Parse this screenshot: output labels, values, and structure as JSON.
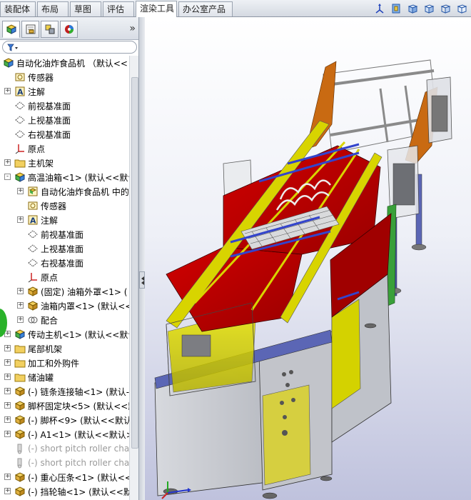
{
  "command_tabs": [
    {
      "label": "装配体",
      "active": false
    },
    {
      "label": "布局",
      "active": false
    },
    {
      "label": "草图",
      "active": false
    },
    {
      "label": "评估",
      "active": false
    },
    {
      "label": "渲染工具",
      "active": true
    },
    {
      "label": "办公室产品",
      "active": false
    }
  ],
  "view_toolbar_icons": [
    "triad-view-icon",
    "section-view-icon",
    "cube-view-icon",
    "cube-view-shaded-icon",
    "cube-view-edges-icon",
    "cube-view-more-icon"
  ],
  "panel_tabs": [
    "feature-manager-icon",
    "property-manager-icon",
    "configuration-manager-icon",
    "appearance-manager-icon"
  ],
  "panel_expand": "»",
  "tree": {
    "items": [
      {
        "label": "自动化油炸食品机 （默认<<",
        "icon": "assembly-root-icon",
        "expander": "",
        "level": 0
      },
      {
        "label": "传感器",
        "icon": "sensor-icon",
        "expander": "",
        "level": 1
      },
      {
        "label": "注解",
        "icon": "annotation-icon",
        "expander": "+",
        "level": 1
      },
      {
        "label": "前视基准面",
        "icon": "plane-icon",
        "expander": "",
        "level": 1
      },
      {
        "label": "上视基准面",
        "icon": "plane-icon",
        "expander": "",
        "level": 1
      },
      {
        "label": "右视基准面",
        "icon": "plane-icon",
        "expander": "",
        "level": 1
      },
      {
        "label": "原点",
        "icon": "origin-icon",
        "expander": "",
        "level": 1
      },
      {
        "label": "主机架",
        "icon": "folder-icon",
        "expander": "+",
        "level": 1
      },
      {
        "label": "高温油箱<1> (默认<<默认",
        "icon": "subassembly-icon",
        "expander": "-",
        "level": 1
      },
      {
        "label": "自动化油炸食品机 中的",
        "icon": "mate-ref-icon",
        "expander": "+",
        "level": 2
      },
      {
        "label": "传感器",
        "icon": "sensor-icon",
        "expander": "",
        "level": 2
      },
      {
        "label": "注解",
        "icon": "annotation-icon",
        "expander": "+",
        "level": 2
      },
      {
        "label": "前视基准面",
        "icon": "plane-icon",
        "expander": "",
        "level": 2
      },
      {
        "label": "上视基准面",
        "icon": "plane-icon",
        "expander": "",
        "level": 2
      },
      {
        "label": "右视基准面",
        "icon": "plane-icon",
        "expander": "",
        "level": 2
      },
      {
        "label": "原点",
        "icon": "origin-icon",
        "expander": "",
        "level": 2
      },
      {
        "label": "(固定) 油箱外罩<1> (",
        "icon": "part-icon",
        "expander": "+",
        "level": 2
      },
      {
        "label": "油箱内罩<1> (默认<<扌",
        "icon": "part-icon",
        "expander": "+",
        "level": 2
      },
      {
        "label": "配合",
        "icon": "mates-icon",
        "expander": "+",
        "level": 2
      },
      {
        "label": "传动主机<1> (默认<<默认",
        "icon": "subassembly-icon",
        "expander": "+",
        "level": 1
      },
      {
        "label": "尾部机架",
        "icon": "folder-icon",
        "expander": "+",
        "level": 1
      },
      {
        "label": "加工和外购件",
        "icon": "folder-icon",
        "expander": "+",
        "level": 1
      },
      {
        "label": "储油罐",
        "icon": "folder-icon",
        "expander": "+",
        "level": 1
      },
      {
        "label": "(-) 链条连接轴<1> (默认-",
        "icon": "part-icon",
        "expander": "+",
        "level": 1
      },
      {
        "label": "脚杯固定块<5> (默认<<默",
        "icon": "part-icon",
        "expander": "+",
        "level": 1
      },
      {
        "label": "(-) 脚杯<9> (默认<<默认",
        "icon": "part-icon",
        "expander": "+",
        "level": 1
      },
      {
        "label": "(-) A1<1> (默认<<默认>",
        "icon": "part-icon",
        "expander": "+",
        "level": 1
      },
      {
        "label": "(-) short pitch roller cha",
        "icon": "suppressed-part-icon",
        "expander": "",
        "level": 1,
        "grey": true
      },
      {
        "label": "(-) short pitch roller cha",
        "icon": "suppressed-part-icon",
        "expander": "",
        "level": 1,
        "grey": true
      },
      {
        "label": "(-) 重心压条<1> (默认<<",
        "icon": "part-icon",
        "expander": "+",
        "level": 1
      },
      {
        "label": "(-) 挡轮轴<1> (默认<<默",
        "icon": "part-icon",
        "expander": "+",
        "level": 1
      }
    ]
  },
  "colors": {
    "frame_grey": "#b9bcc4",
    "hood_red": "#c40000",
    "rail_yellow": "#d8d400",
    "bracket_orange": "#c96a12",
    "rod_blue": "#3344cc",
    "base_blue": "#5b66b5"
  }
}
